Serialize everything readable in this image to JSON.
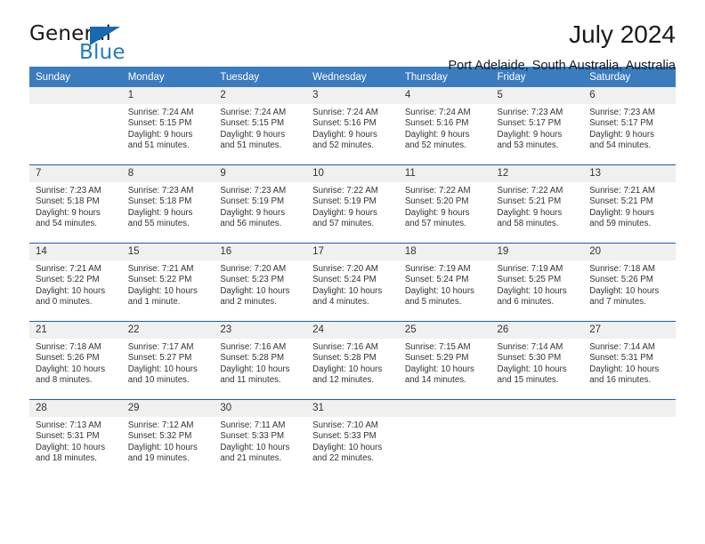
{
  "brand": {
    "name_dark": "General",
    "name_light": "Blue",
    "triangle_color": "#1769b0",
    "blue_color": "#1f7ac4"
  },
  "header": {
    "title": "July 2024",
    "subtitle": "Port Adelaide, South Australia, Australia",
    "header_bg_color": "#3b7cbf",
    "row_divider_color": "#1b5fa8",
    "daynum_bg_color": "#f0f0f0"
  },
  "weekdays": [
    "Sunday",
    "Monday",
    "Tuesday",
    "Wednesday",
    "Thursday",
    "Friday",
    "Saturday"
  ],
  "weeks": [
    [
      {
        "day": "",
        "sunrise": "",
        "sunset": "",
        "daylight1": "",
        "daylight2": ""
      },
      {
        "day": "1",
        "sunrise": "Sunrise: 7:24 AM",
        "sunset": "Sunset: 5:15 PM",
        "daylight1": "Daylight: 9 hours",
        "daylight2": "and 51 minutes."
      },
      {
        "day": "2",
        "sunrise": "Sunrise: 7:24 AM",
        "sunset": "Sunset: 5:15 PM",
        "daylight1": "Daylight: 9 hours",
        "daylight2": "and 51 minutes."
      },
      {
        "day": "3",
        "sunrise": "Sunrise: 7:24 AM",
        "sunset": "Sunset: 5:16 PM",
        "daylight1": "Daylight: 9 hours",
        "daylight2": "and 52 minutes."
      },
      {
        "day": "4",
        "sunrise": "Sunrise: 7:24 AM",
        "sunset": "Sunset: 5:16 PM",
        "daylight1": "Daylight: 9 hours",
        "daylight2": "and 52 minutes."
      },
      {
        "day": "5",
        "sunrise": "Sunrise: 7:23 AM",
        "sunset": "Sunset: 5:17 PM",
        "daylight1": "Daylight: 9 hours",
        "daylight2": "and 53 minutes."
      },
      {
        "day": "6",
        "sunrise": "Sunrise: 7:23 AM",
        "sunset": "Sunset: 5:17 PM",
        "daylight1": "Daylight: 9 hours",
        "daylight2": "and 54 minutes."
      }
    ],
    [
      {
        "day": "7",
        "sunrise": "Sunrise: 7:23 AM",
        "sunset": "Sunset: 5:18 PM",
        "daylight1": "Daylight: 9 hours",
        "daylight2": "and 54 minutes."
      },
      {
        "day": "8",
        "sunrise": "Sunrise: 7:23 AM",
        "sunset": "Sunset: 5:18 PM",
        "daylight1": "Daylight: 9 hours",
        "daylight2": "and 55 minutes."
      },
      {
        "day": "9",
        "sunrise": "Sunrise: 7:23 AM",
        "sunset": "Sunset: 5:19 PM",
        "daylight1": "Daylight: 9 hours",
        "daylight2": "and 56 minutes."
      },
      {
        "day": "10",
        "sunrise": "Sunrise: 7:22 AM",
        "sunset": "Sunset: 5:19 PM",
        "daylight1": "Daylight: 9 hours",
        "daylight2": "and 57 minutes."
      },
      {
        "day": "11",
        "sunrise": "Sunrise: 7:22 AM",
        "sunset": "Sunset: 5:20 PM",
        "daylight1": "Daylight: 9 hours",
        "daylight2": "and 57 minutes."
      },
      {
        "day": "12",
        "sunrise": "Sunrise: 7:22 AM",
        "sunset": "Sunset: 5:21 PM",
        "daylight1": "Daylight: 9 hours",
        "daylight2": "and 58 minutes."
      },
      {
        "day": "13",
        "sunrise": "Sunrise: 7:21 AM",
        "sunset": "Sunset: 5:21 PM",
        "daylight1": "Daylight: 9 hours",
        "daylight2": "and 59 minutes."
      }
    ],
    [
      {
        "day": "14",
        "sunrise": "Sunrise: 7:21 AM",
        "sunset": "Sunset: 5:22 PM",
        "daylight1": "Daylight: 10 hours",
        "daylight2": "and 0 minutes."
      },
      {
        "day": "15",
        "sunrise": "Sunrise: 7:21 AM",
        "sunset": "Sunset: 5:22 PM",
        "daylight1": "Daylight: 10 hours",
        "daylight2": "and 1 minute."
      },
      {
        "day": "16",
        "sunrise": "Sunrise: 7:20 AM",
        "sunset": "Sunset: 5:23 PM",
        "daylight1": "Daylight: 10 hours",
        "daylight2": "and 2 minutes."
      },
      {
        "day": "17",
        "sunrise": "Sunrise: 7:20 AM",
        "sunset": "Sunset: 5:24 PM",
        "daylight1": "Daylight: 10 hours",
        "daylight2": "and 4 minutes."
      },
      {
        "day": "18",
        "sunrise": "Sunrise: 7:19 AM",
        "sunset": "Sunset: 5:24 PM",
        "daylight1": "Daylight: 10 hours",
        "daylight2": "and 5 minutes."
      },
      {
        "day": "19",
        "sunrise": "Sunrise: 7:19 AM",
        "sunset": "Sunset: 5:25 PM",
        "daylight1": "Daylight: 10 hours",
        "daylight2": "and 6 minutes."
      },
      {
        "day": "20",
        "sunrise": "Sunrise: 7:18 AM",
        "sunset": "Sunset: 5:26 PM",
        "daylight1": "Daylight: 10 hours",
        "daylight2": "and 7 minutes."
      }
    ],
    [
      {
        "day": "21",
        "sunrise": "Sunrise: 7:18 AM",
        "sunset": "Sunset: 5:26 PM",
        "daylight1": "Daylight: 10 hours",
        "daylight2": "and 8 minutes."
      },
      {
        "day": "22",
        "sunrise": "Sunrise: 7:17 AM",
        "sunset": "Sunset: 5:27 PM",
        "daylight1": "Daylight: 10 hours",
        "daylight2": "and 10 minutes."
      },
      {
        "day": "23",
        "sunrise": "Sunrise: 7:16 AM",
        "sunset": "Sunset: 5:28 PM",
        "daylight1": "Daylight: 10 hours",
        "daylight2": "and 11 minutes."
      },
      {
        "day": "24",
        "sunrise": "Sunrise: 7:16 AM",
        "sunset": "Sunset: 5:28 PM",
        "daylight1": "Daylight: 10 hours",
        "daylight2": "and 12 minutes."
      },
      {
        "day": "25",
        "sunrise": "Sunrise: 7:15 AM",
        "sunset": "Sunset: 5:29 PM",
        "daylight1": "Daylight: 10 hours",
        "daylight2": "and 14 minutes."
      },
      {
        "day": "26",
        "sunrise": "Sunrise: 7:14 AM",
        "sunset": "Sunset: 5:30 PM",
        "daylight1": "Daylight: 10 hours",
        "daylight2": "and 15 minutes."
      },
      {
        "day": "27",
        "sunrise": "Sunrise: 7:14 AM",
        "sunset": "Sunset: 5:31 PM",
        "daylight1": "Daylight: 10 hours",
        "daylight2": "and 16 minutes."
      }
    ],
    [
      {
        "day": "28",
        "sunrise": "Sunrise: 7:13 AM",
        "sunset": "Sunset: 5:31 PM",
        "daylight1": "Daylight: 10 hours",
        "daylight2": "and 18 minutes."
      },
      {
        "day": "29",
        "sunrise": "Sunrise: 7:12 AM",
        "sunset": "Sunset: 5:32 PM",
        "daylight1": "Daylight: 10 hours",
        "daylight2": "and 19 minutes."
      },
      {
        "day": "30",
        "sunrise": "Sunrise: 7:11 AM",
        "sunset": "Sunset: 5:33 PM",
        "daylight1": "Daylight: 10 hours",
        "daylight2": "and 21 minutes."
      },
      {
        "day": "31",
        "sunrise": "Sunrise: 7:10 AM",
        "sunset": "Sunset: 5:33 PM",
        "daylight1": "Daylight: 10 hours",
        "daylight2": "and 22 minutes."
      },
      {
        "day": "",
        "sunrise": "",
        "sunset": "",
        "daylight1": "",
        "daylight2": ""
      },
      {
        "day": "",
        "sunrise": "",
        "sunset": "",
        "daylight1": "",
        "daylight2": ""
      },
      {
        "day": "",
        "sunrise": "",
        "sunset": "",
        "daylight1": "",
        "daylight2": ""
      }
    ]
  ]
}
